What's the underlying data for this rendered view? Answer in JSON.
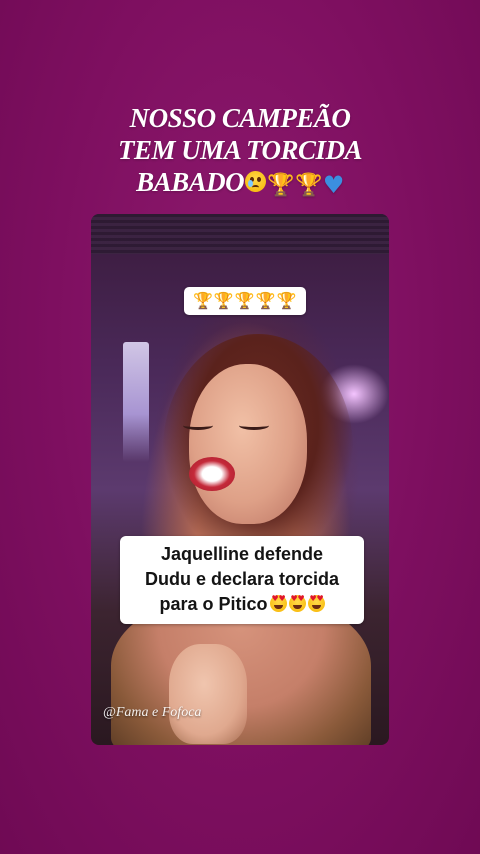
{
  "story": {
    "caption_lines": [
      "NOSSO CAMPEÃO",
      "TEM UMA TORCIDA",
      "BABADO"
    ],
    "caption_emojis": [
      "pleading-face-with-tear-icon",
      "trophy-icon",
      "trophy-icon",
      "blue-heart-icon"
    ],
    "background_color": "#7e0f60"
  },
  "video": {
    "trophy_pill": [
      "🏆",
      "🏆",
      "🏆",
      "🏆",
      "🏆"
    ],
    "text_lines": [
      "Jaquelline defende",
      "Dudu e declara torcida",
      "para o Pitico"
    ],
    "text_emojis": [
      "heart-eyes-icon",
      "heart-eyes-icon",
      "heart-eyes-icon"
    ],
    "watermark": "@Fama e Fofoca"
  }
}
